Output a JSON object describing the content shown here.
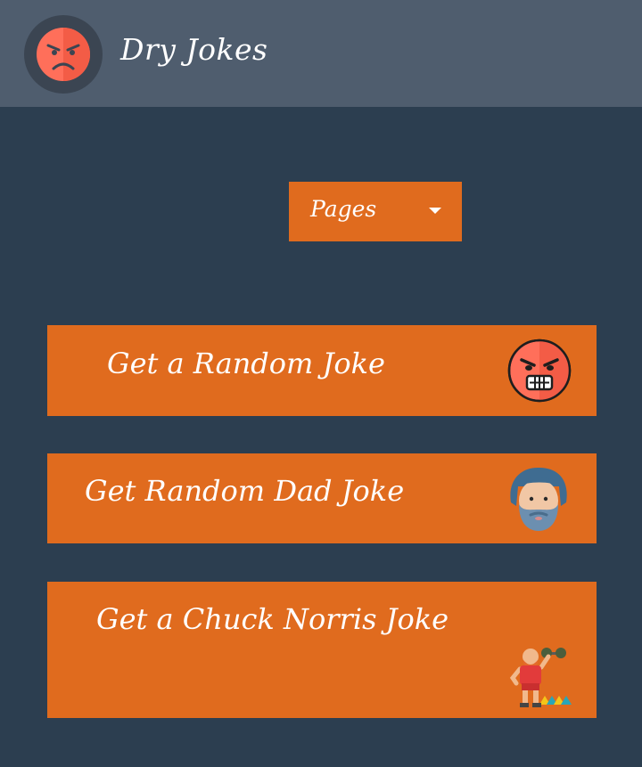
{
  "navbar": {
    "brand": "Dry Jokes",
    "logo_icon": "angry-face-icon"
  },
  "dropdown": {
    "label": "Pages",
    "caret_icon": "caret-down-icon"
  },
  "buttons": [
    {
      "label": "Get a Random Joke",
      "icon": "angry-face-gritted-teeth-icon"
    },
    {
      "label": "Get Random Dad Joke",
      "icon": "bearded-man-icon"
    },
    {
      "label": "Get a Chuck Norris Joke",
      "icon": "weightlifter-icon"
    }
  ],
  "colors": {
    "background": "#2c3e50",
    "navbar": "#4f5d6e",
    "accent": "#e06b1e",
    "text": "#ffffff"
  }
}
